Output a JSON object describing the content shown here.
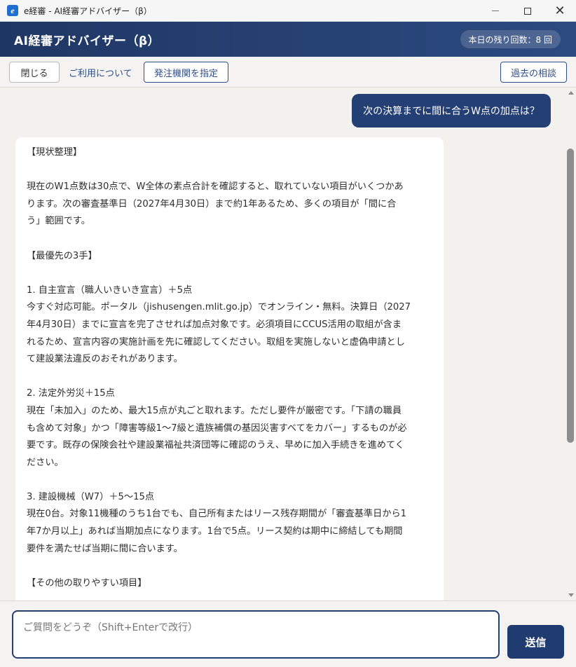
{
  "window": {
    "icon": "e-logo-icon",
    "title": "e経審 - AI経審アドバイザー（β）"
  },
  "header": {
    "title": "AI経審アドバイザー（β）",
    "quota": "本日の残り回数：8 回"
  },
  "toolbar": {
    "close_label": "閉じる",
    "about_label": "ご利用について",
    "specify_label": "発注機関を指定",
    "history_label": "過去の相談"
  },
  "chat": {
    "user_message": "次の決算までに間に合うW点の加点は？",
    "ai_lines": [
      "【現状整理】",
      "",
      "現在のW1点数は30点で、W全体の素点合計を確認すると、取れていない項目がいくつかあ",
      "ります。次の審査基準日（2027年4月30日）まで約1年あるため、多くの項目が「間に合",
      "う」範囲です。",
      "",
      "【最優先の3手】",
      "",
      "1. 自主宣言（職人いきいき宣言）＋5点",
      "今すぐ対応可能。ポータル（jishusengen.mlit.go.jp）でオンライン・無料。決算日（2027",
      "年4月30日）までに宣言を完了させれば加点対象です。必須項目にCCUS活用の取組が含ま",
      "れるため、宣言内容の実施計画を先に確認してください。取組を実施しないと虚偽申請とし",
      "て建設業法違反のおそれがあります。",
      "",
      "2. 法定外労災＋15点",
      "現在「未加入」のため、最大15点が丸ごと取れます。ただし要件が厳密です。「下請の職員",
      "も含めて対象」かつ「障害等級1〜7級と遺族補償の基因災害すべてをカバー」するものが必",
      "要です。既存の保険会社や建設業福祉共済団等に確認のうえ、早めに加入手続きを進めてく",
      "ださい。",
      "",
      "3. 建設機械（W7）＋5〜15点",
      "現在0台。対象11機種のうち1台でも、自己所有またはリース残存期間が「審査基準日から1",
      "年7か月以上」あれば当期加点になります。1台で5点。リース契約は期中に締結しても期間",
      "要件を満たせば当期に間に合います。",
      "",
      "【その他の取りやすい項目】"
    ]
  },
  "composer": {
    "placeholder": "ご質問をどうぞ（Shift+Enterで改行）",
    "send_label": "送信"
  },
  "colors": {
    "header": "#243f74",
    "accent": "#2f4f88",
    "background": "#f3f1ee"
  }
}
